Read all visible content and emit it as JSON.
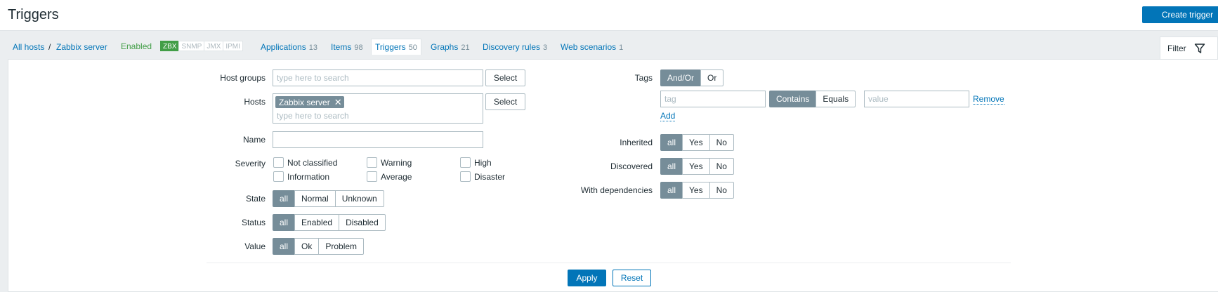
{
  "header": {
    "title": "Triggers",
    "create_label": "Create trigger"
  },
  "nav": {
    "breadcrumb_all_hosts": "All hosts",
    "breadcrumb_sep": "/",
    "breadcrumb_host": "Zabbix server",
    "status": "Enabled",
    "badges": [
      "ZBX",
      "SNMP",
      "JMX",
      "IPMI"
    ],
    "tabs": [
      {
        "label": "Applications",
        "count": "13"
      },
      {
        "label": "Items",
        "count": "98"
      },
      {
        "label": "Triggers",
        "count": "50"
      },
      {
        "label": "Graphs",
        "count": "21"
      },
      {
        "label": "Discovery rules",
        "count": "3"
      },
      {
        "label": "Web scenarios",
        "count": "1"
      }
    ],
    "filter_label": "Filter"
  },
  "filter": {
    "host_groups_label": "Host groups",
    "host_groups_placeholder": "type here to search",
    "select_label": "Select",
    "hosts_label": "Hosts",
    "hosts_chip": "Zabbix server",
    "hosts_placeholder": "type here to search",
    "name_label": "Name",
    "name_value": "",
    "severity_label": "Severity",
    "severities": [
      "Not classified",
      "Warning",
      "High",
      "Information",
      "Average",
      "Disaster"
    ],
    "state_label": "State",
    "state_options": [
      "all",
      "Normal",
      "Unknown"
    ],
    "status_label": "Status",
    "status_options": [
      "all",
      "Enabled",
      "Disabled"
    ],
    "value_label": "Value",
    "value_options": [
      "all",
      "Ok",
      "Problem"
    ],
    "tags_label": "Tags",
    "tags_mode_options": [
      "And/Or",
      "Or"
    ],
    "tag_placeholder": "tag",
    "tag_operator_options": [
      "Contains",
      "Equals"
    ],
    "value_placeholder": "value",
    "remove_label": "Remove",
    "add_label": "Add",
    "inherited_label": "Inherited",
    "discovered_label": "Discovered",
    "dependencies_label": "With dependencies",
    "yes_no_options": [
      "all",
      "Yes",
      "No"
    ],
    "apply_label": "Apply",
    "reset_label": "Reset"
  },
  "colors": {
    "link": "#0275b8",
    "enabled_green": "#429e47",
    "selected_segment": "#768d99"
  }
}
